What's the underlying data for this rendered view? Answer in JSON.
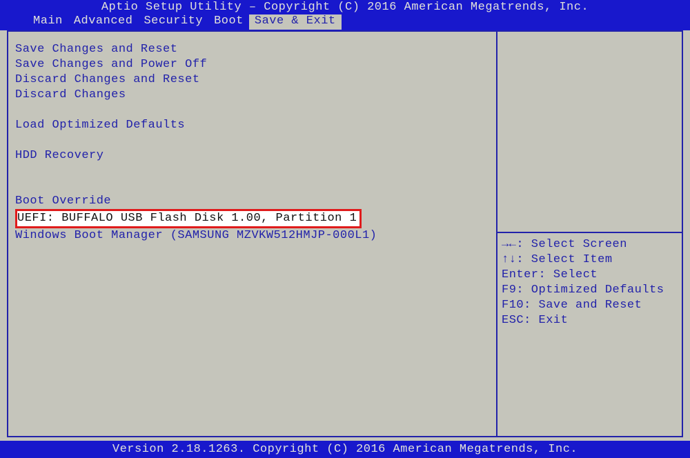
{
  "header": {
    "title": "Aptio Setup Utility – Copyright (C) 2016 American Megatrends, Inc.",
    "tabs": [
      "Main",
      "Advanced",
      "Security",
      "Boot",
      "Save & Exit"
    ],
    "active_tab": 4
  },
  "menu": {
    "items": [
      "Save Changes and Reset",
      "Save Changes and Power Off",
      "Discard Changes and Reset",
      "Discard Changes"
    ],
    "load_defaults": "Load Optimized Defaults",
    "hdd_recovery": "HDD Recovery",
    "boot_override_label": "Boot Override",
    "boot_entries": [
      "UEFI: BUFFALO USB Flash Disk 1.00, Partition 1",
      "Windows Boot Manager (SAMSUNG MZVKW512HMJP-000L1)"
    ],
    "highlighted_index": 0
  },
  "help": {
    "select_screen": "→←: Select Screen",
    "select_item": "↑↓: Select Item",
    "enter": "Enter: Select",
    "f9": "F9: Optimized Defaults",
    "f10": "F10: Save and Reset",
    "esc": "ESC: Exit"
  },
  "footer": {
    "text": "Version 2.18.1263. Copyright (C) 2016 American Megatrends, Inc."
  }
}
